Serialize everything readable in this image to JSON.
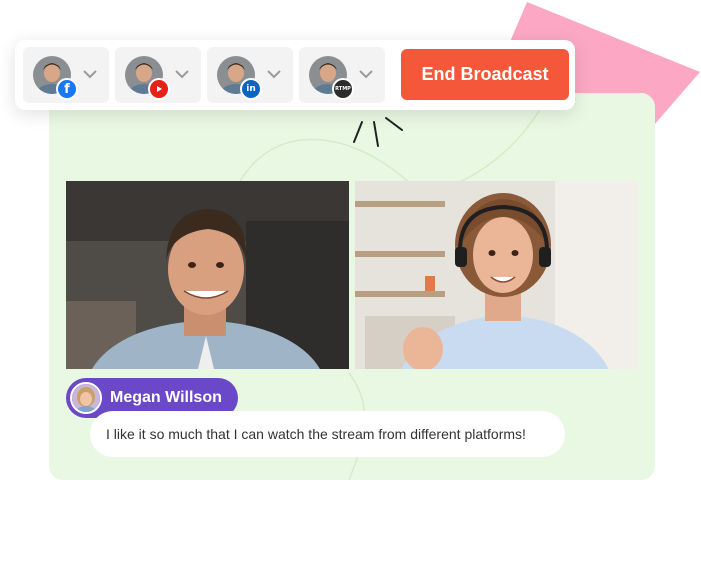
{
  "toolbar": {
    "destinations": [
      {
        "platform": "Facebook",
        "badge_icon": "facebook-icon",
        "badge_text": "f"
      },
      {
        "platform": "YouTube",
        "badge_icon": "youtube-icon",
        "badge_text": ""
      },
      {
        "platform": "LinkedIn",
        "badge_icon": "linkedin-icon",
        "badge_text": "in"
      },
      {
        "platform": "RTMP",
        "badge_icon": "rtmp-icon",
        "badge_text": "RTMP"
      }
    ],
    "end_button_label": "End Broadcast"
  },
  "chat": {
    "author": "Megan Willson",
    "message": "I like it so much that I can watch the stream from different platforms!"
  },
  "colors": {
    "accent": "#f4573a",
    "stage_bg": "#e9f8e2",
    "pill": "#6a48c7",
    "decor_pink": "#fca8c4"
  }
}
